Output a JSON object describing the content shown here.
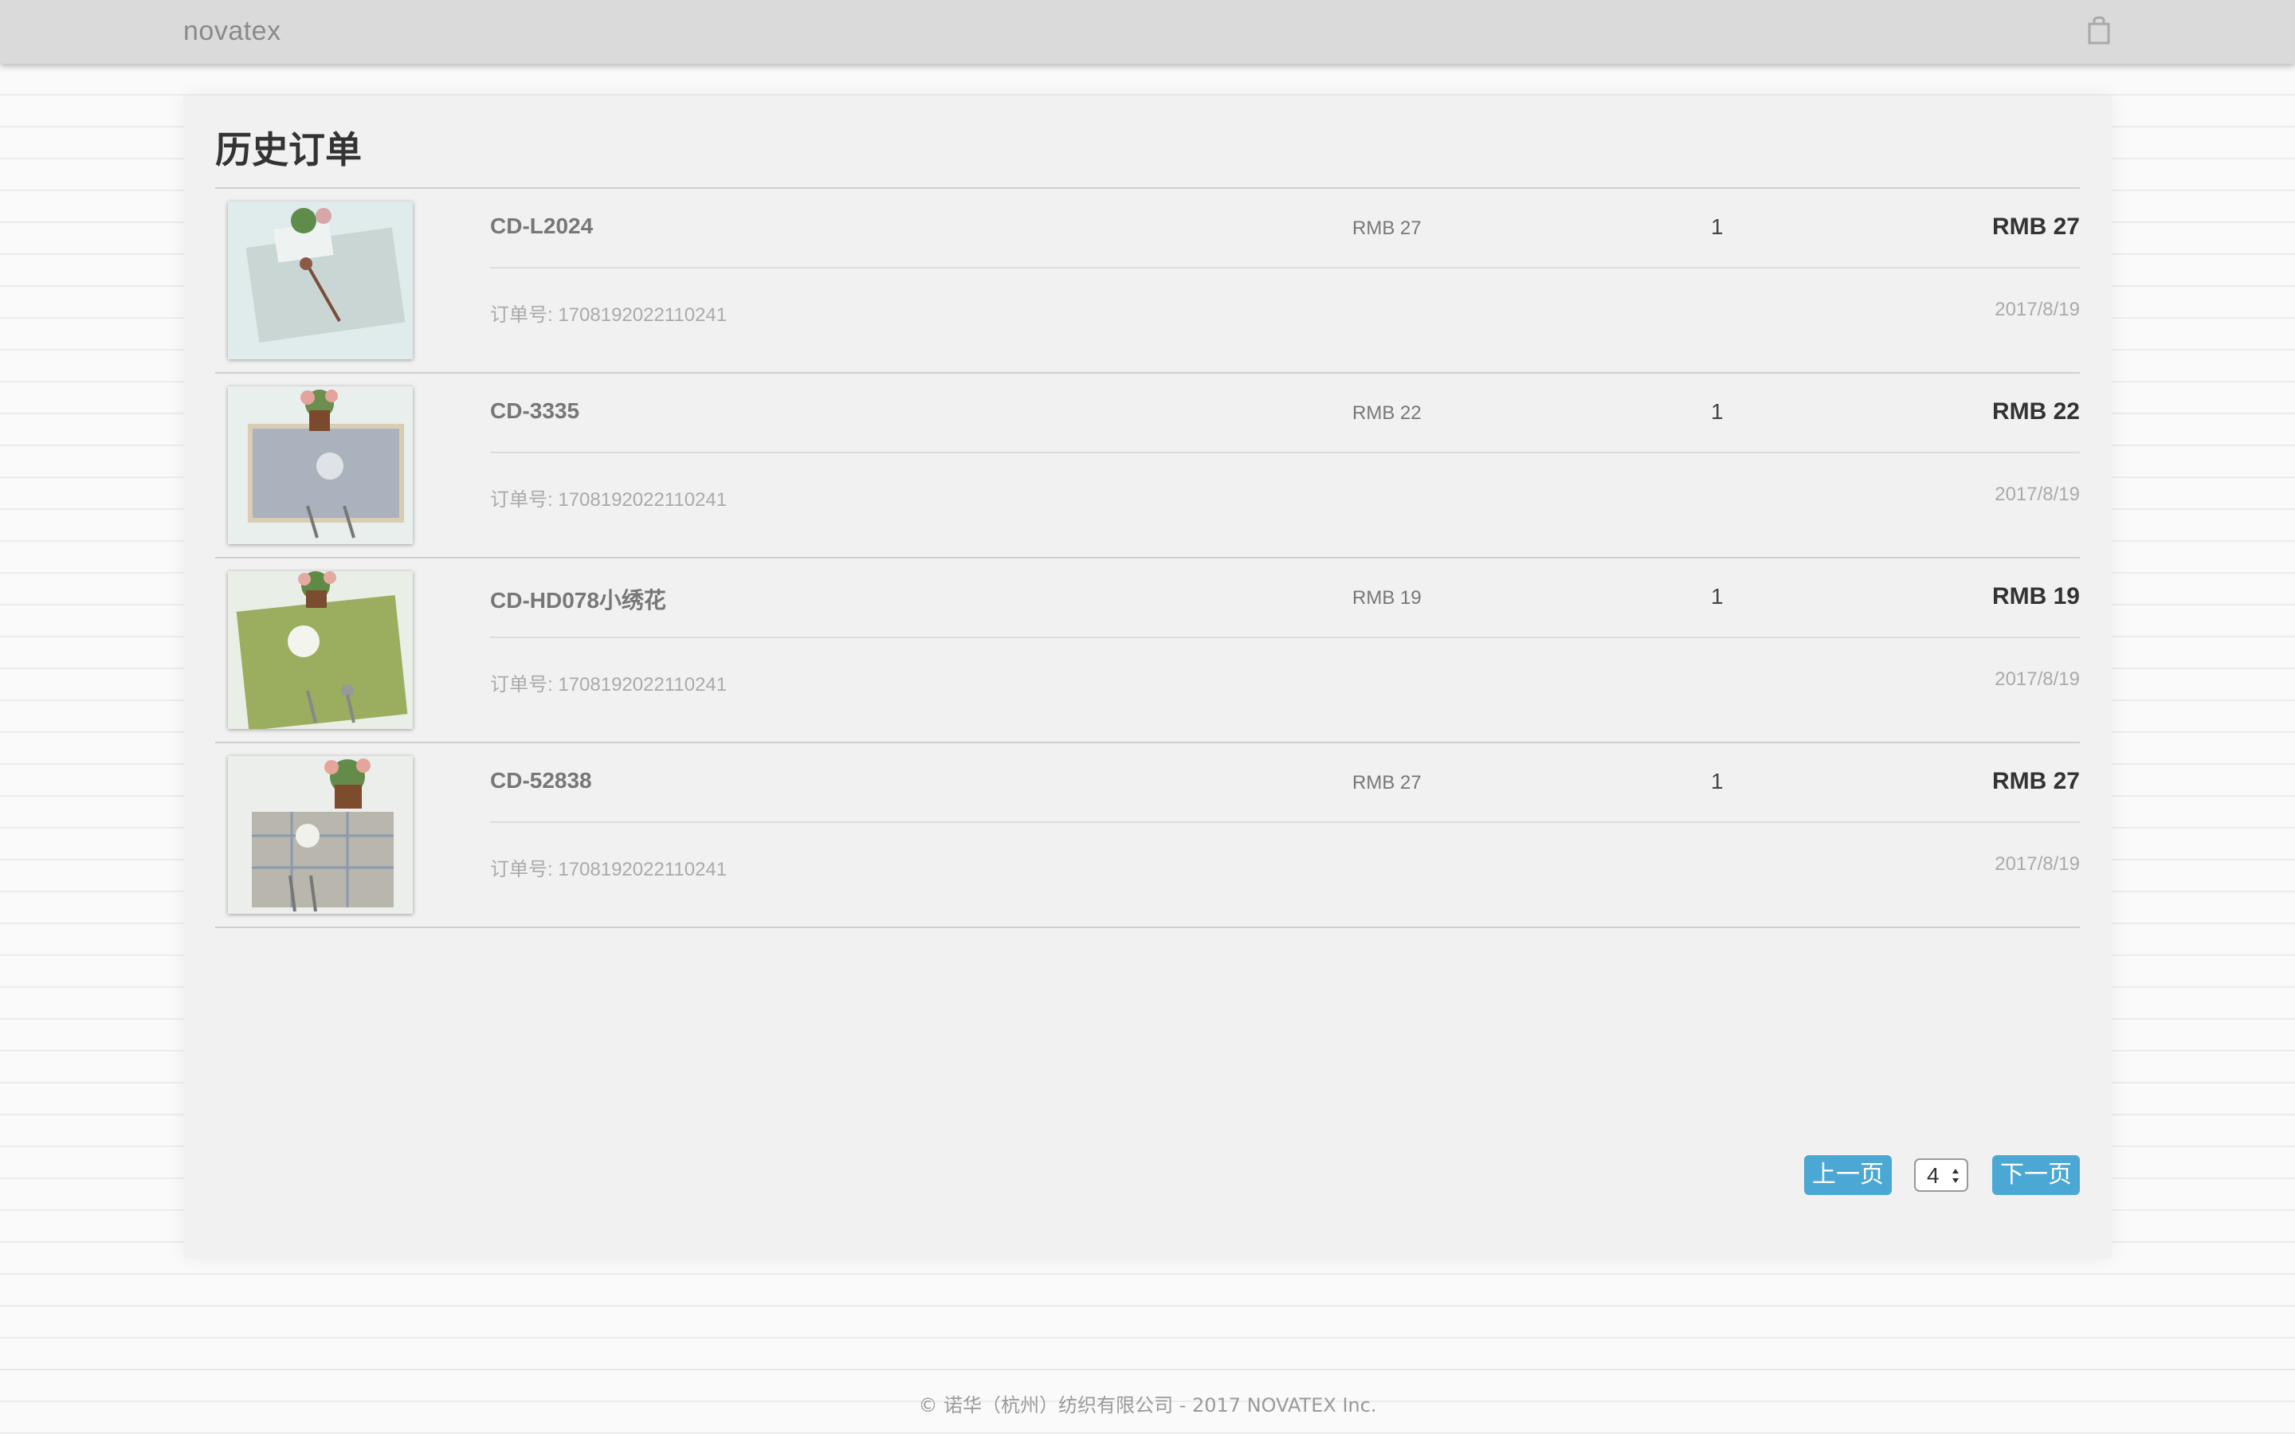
{
  "header": {
    "brand": "novatex",
    "cart_icon": "shopping-bag-icon"
  },
  "page": {
    "title": "历史订单"
  },
  "orders": [
    {
      "name": "CD-L2024",
      "unit_price": "RMB 27",
      "quantity": "1",
      "total": "RMB 27",
      "order_no": "订单号: 1708192022110241",
      "date": "2017/8/19",
      "image_colors": {
        "bg": "#dfeceb",
        "mat": "#c9d6d4"
      }
    },
    {
      "name": "CD-3335",
      "unit_price": "RMB 22",
      "quantity": "1",
      "total": "RMB 22",
      "order_no": "订单号: 1708192022110241",
      "date": "2017/8/19",
      "image_colors": {
        "bg": "#e8efec",
        "mat": "#aab3bd"
      }
    },
    {
      "name": "CD-HD078小绣花",
      "unit_price": "RMB 19",
      "quantity": "1",
      "total": "RMB 19",
      "order_no": "订单号: 1708192022110241",
      "date": "2017/8/19",
      "image_colors": {
        "bg": "#e9eee6",
        "mat": "#9bad5e"
      }
    },
    {
      "name": "CD-52838",
      "unit_price": "RMB 27",
      "quantity": "1",
      "total": "RMB 27",
      "order_no": "订单号: 1708192022110241",
      "date": "2017/8/19",
      "image_colors": {
        "bg": "#eceeec",
        "mat": "#b8b6ad"
      }
    }
  ],
  "pagination": {
    "prev_label": "上一页",
    "current_page": "4",
    "next_label": "下一页"
  },
  "footer": {
    "text": "© 诺华（杭州）纺织有限公司 - 2017 NOVATEX Inc."
  },
  "colors": {
    "accent": "#4ba8d4",
    "topbar": "#dadada",
    "panel": "#f1f1f1"
  }
}
